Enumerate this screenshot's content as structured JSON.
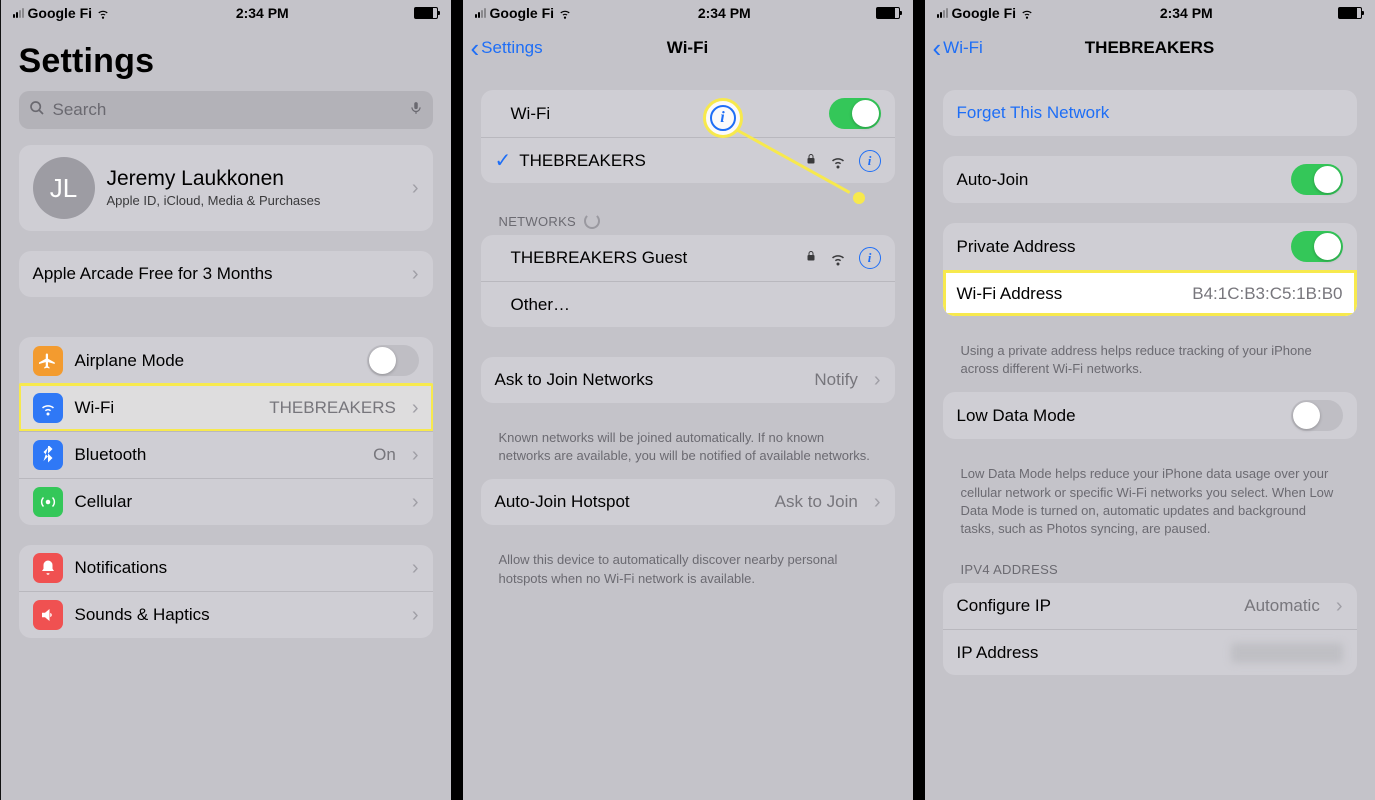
{
  "status": {
    "carrier": "Google Fi",
    "time": "2:34 PM"
  },
  "screen1": {
    "title": "Settings",
    "search_placeholder": "Search",
    "profile": {
      "initials": "JL",
      "name": "Jeremy Laukkonen",
      "sub": "Apple ID, iCloud, Media & Purchases"
    },
    "arcade": "Apple Arcade Free for 3 Months",
    "items": {
      "airplane": "Airplane Mode",
      "wifi": "Wi-Fi",
      "wifi_value": "THEBREAKERS",
      "bt": "Bluetooth",
      "bt_value": "On",
      "cell": "Cellular",
      "notif": "Notifications",
      "sound": "Sounds & Haptics"
    }
  },
  "screen2": {
    "back": "Settings",
    "title": "Wi-Fi",
    "wifi_label": "Wi-Fi",
    "connected": "THEBREAKERS",
    "networks_hdr": "NETWORKS",
    "guest": "THEBREAKERS Guest",
    "other": "Other…",
    "ask_join": "Ask to Join Networks",
    "ask_join_value": "Notify",
    "ask_join_foot": "Known networks will be joined automatically. If no known networks are available, you will be notified of available networks.",
    "auto_hotspot": "Auto-Join Hotspot",
    "auto_hotspot_value": "Ask to Join",
    "auto_hotspot_foot": "Allow this device to automatically discover nearby personal hotspots when no Wi-Fi network is available."
  },
  "screen3": {
    "back": "Wi-Fi",
    "title": "THEBREAKERS",
    "forget": "Forget This Network",
    "autojoin": "Auto-Join",
    "private_addr": "Private Address",
    "wifi_addr_label": "Wi-Fi Address",
    "wifi_addr_value": "B4:1C:B3:C5:1B:B0",
    "private_foot": "Using a private address helps reduce tracking of your iPhone across different Wi-Fi networks.",
    "low_data": "Low Data Mode",
    "low_data_foot": "Low Data Mode helps reduce your iPhone data usage over your cellular network or specific Wi-Fi networks you select. When Low Data Mode is turned on, automatic updates and background tasks, such as Photos syncing, are paused.",
    "ipv4_hdr": "IPV4 ADDRESS",
    "configure_ip": "Configure IP",
    "configure_ip_value": "Automatic",
    "ip_addr": "IP Address",
    "ip_addr_value": "redacted"
  }
}
